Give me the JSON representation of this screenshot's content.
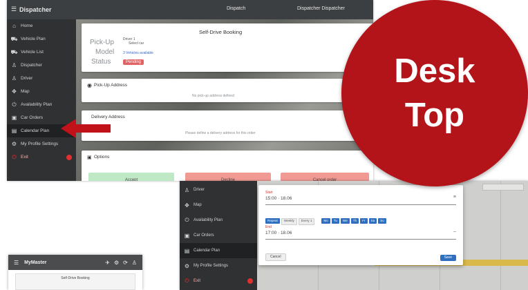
{
  "badge": {
    "line1": "Desk",
    "line2": "Top"
  },
  "colors": {
    "badge_red": "#b31419",
    "sidebar_dark": "#2f3133",
    "topbar": "#3c3f41",
    "logout_red": "#e23b3b"
  },
  "shot1": {
    "app_title": "Dispatcher",
    "user_menu": [
      "Dispatch",
      "Dispatcher Dispatcher"
    ],
    "nav": [
      {
        "icon": "home-icon",
        "label": "Home"
      },
      {
        "icon": "vehicle-icon",
        "label": "Vehicle Plan"
      },
      {
        "icon": "vehicle-icon",
        "label": "Vehicle List"
      },
      {
        "icon": "user-icon",
        "label": "Dispatcher"
      },
      {
        "icon": "user-icon",
        "label": "Driver"
      },
      {
        "icon": "map-icon",
        "label": "Map"
      },
      {
        "icon": "power-icon",
        "label": "Availability Plan"
      },
      {
        "icon": "car-icon",
        "label": "Car Orders"
      },
      {
        "icon": "calendar-icon",
        "label": "Calendar Plan"
      },
      {
        "icon": "settings-icon",
        "label": "My Profile Settings"
      },
      {
        "icon": "logout-icon",
        "label": "Exit"
      }
    ],
    "order_card": {
      "title": "Self-Drive Booking",
      "rows": [
        {
          "label": "Pick-Up",
          "value": "Driver 1"
        },
        {
          "label": "Model",
          "value": "3 Vehicles available"
        },
        {
          "label": "Status",
          "value": "Pending"
        }
      ],
      "sub_value": "Select car"
    },
    "section_a": {
      "title": "Pick-Up Address",
      "body": "No pick-up address defined"
    },
    "section_b": {
      "title": "Delivery Address",
      "body": "Please define a delivery address for this order"
    },
    "section_c": {
      "title": "Options",
      "buttons": [
        "Accept",
        "Decline",
        "Cancel order"
      ]
    }
  },
  "shot2": {
    "nav": [
      {
        "icon": "user-icon",
        "label": "Driver"
      },
      {
        "icon": "map-icon",
        "label": "Map"
      },
      {
        "icon": "power-icon",
        "label": "Availability Plan"
      },
      {
        "icon": "car-icon",
        "label": "Car Orders"
      },
      {
        "icon": "calendar-icon",
        "label": "Calendar Plan"
      },
      {
        "icon": "settings-icon",
        "label": "My Profile Settings"
      },
      {
        "icon": "logout-icon",
        "label": "Exit"
      }
    ],
    "dialog": {
      "field1_label": "Start",
      "field1_value": "15:00 · 18.06",
      "chips_left": [
        "Repeat",
        "Weekly",
        "Every 1"
      ],
      "chips_right": [
        "Mo",
        "Tu",
        "We",
        "Th",
        "Fr",
        "Sa",
        "Su"
      ],
      "field2_label": "End",
      "field2_value": "17:00 · 18.06",
      "cancel_label": "Cancel",
      "save_label": "Save"
    }
  },
  "shot3": {
    "app_title": "MyMaster",
    "card_title": "Self-Drive Booking"
  }
}
